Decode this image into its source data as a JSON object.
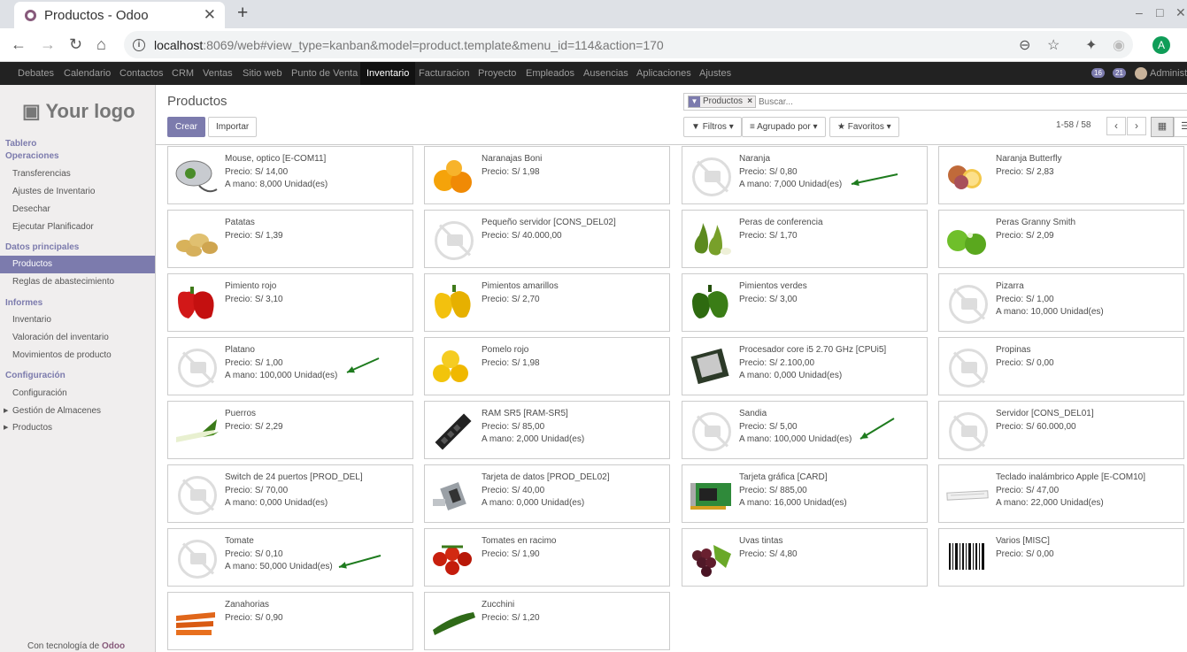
{
  "browser": {
    "tab_title": "Productos - Odoo",
    "url_host": "localhost",
    "url_rest": ":8069/web#view_type=kanban&model=product.template&menu_id=114&action=170",
    "profile_initial": "A"
  },
  "topmenu": {
    "items": [
      "Debates",
      "Calendario",
      "Contactos",
      "CRM",
      "Ventas",
      "Sitio web",
      "Punto de Venta",
      "Inventario",
      "Facturacion",
      "Proyecto",
      "Empleados",
      "Ausencias",
      "Aplicaciones",
      "Ajustes"
    ],
    "active": "Inventario",
    "badge_messages": "16",
    "badge_activities": "21",
    "user": "Administr"
  },
  "sidebar": {
    "logo": "Your logo",
    "dashboard": "Tablero",
    "sections": [
      {
        "title": "Operaciones",
        "items": [
          "Transferencias",
          "Ajustes de Inventario",
          "Desechar",
          "Ejecutar Planificador"
        ]
      },
      {
        "title": "Datos principales",
        "items": [
          "Productos",
          "Reglas de abastecimiento"
        ]
      },
      {
        "title": "Informes",
        "items": [
          "Inventario",
          "Valoración del inventario",
          "Movimientos de producto"
        ]
      },
      {
        "title": "Configuración",
        "items": [
          "Configuración",
          "Gestión de Almacenes",
          "Productos"
        ]
      }
    ],
    "selected": "Productos",
    "powered_prefix": "Con tecnología de ",
    "powered_brand": "Odoo"
  },
  "control_panel": {
    "title": "Productos",
    "create": "Crear",
    "import": "Importar",
    "facet": "Productos",
    "search_placeholder": "Buscar...",
    "filters": "Filtros",
    "group_by": "Agrupado por",
    "favorites": "Favoritos",
    "pager": "1-58 / 58"
  },
  "products": [
    {
      "name": "Mouse, optico [E-COM11]",
      "price": "Precio: S/ 14,00",
      "stock": "A mano: 8,000 Unidad(es)",
      "icon": "mouse"
    },
    {
      "name": "Naranajas Boni",
      "price": "Precio: S/ 1,98",
      "stock": "",
      "icon": "oranges"
    },
    {
      "name": "Naranja",
      "price": "Precio: S/ 0,80",
      "stock": "A mano: 7,000 Unidad(es)",
      "icon": "placeholder"
    },
    {
      "name": "Naranja Butterfly",
      "price": "Precio: S/ 2,83",
      "stock": "",
      "icon": "orange-slices"
    },
    {
      "name": "Patatas",
      "price": "Precio: S/ 1,39",
      "stock": "",
      "icon": "potatoes"
    },
    {
      "name": "Pequeño servidor [CONS_DEL02]",
      "price": "Precio: S/ 40.000,00",
      "stock": "",
      "icon": "placeholder"
    },
    {
      "name": "Peras de conferencia",
      "price": "Precio: S/ 1,70",
      "stock": "",
      "icon": "pears"
    },
    {
      "name": "Peras Granny Smith",
      "price": "Precio: S/ 2,09",
      "stock": "",
      "icon": "apples"
    },
    {
      "name": "Pimiento rojo",
      "price": "Precio: S/ 3,10",
      "stock": "",
      "icon": "red-pepper"
    },
    {
      "name": "Pimientos amarillos",
      "price": "Precio: S/ 2,70",
      "stock": "",
      "icon": "yellow-pepper"
    },
    {
      "name": "Pimientos verdes",
      "price": "Precio: S/ 3,00",
      "stock": "",
      "icon": "green-pepper"
    },
    {
      "name": "Pizarra",
      "price": "Precio: S/ 1,00",
      "stock": "A mano: 10,000 Unidad(es)",
      "icon": "placeholder"
    },
    {
      "name": "Platano",
      "price": "Precio: S/ 1,00",
      "stock": "A mano: 100,000 Unidad(es)",
      "icon": "placeholder"
    },
    {
      "name": "Pomelo rojo",
      "price": "Precio: S/ 1,98",
      "stock": "",
      "icon": "grapefruit"
    },
    {
      "name": "Procesador core i5 2.70 GHz [CPUi5]",
      "price": "Precio: S/ 2.100,00",
      "stock": "A mano: 0,000 Unidad(es)",
      "icon": "cpu"
    },
    {
      "name": "Propinas",
      "price": "Precio: S/ 0,00",
      "stock": "",
      "icon": "placeholder"
    },
    {
      "name": "Puerros",
      "price": "Precio: S/ 2,29",
      "stock": "",
      "icon": "leeks"
    },
    {
      "name": "RAM SR5 [RAM-SR5]",
      "price": "Precio: S/ 85,00",
      "stock": "A mano: 2,000 Unidad(es)",
      "icon": "ram"
    },
    {
      "name": "Sandia",
      "price": "Precio: S/ 5,00",
      "stock": "A mano: 100,000 Unidad(es)",
      "icon": "placeholder"
    },
    {
      "name": "Servidor [CONS_DEL01]",
      "price": "Precio: S/ 60.000,00",
      "stock": "",
      "icon": "placeholder"
    },
    {
      "name": "Switch de 24 puertos [PROD_DEL]",
      "price": "Precio: S/ 70,00",
      "stock": "A mano: 0,000 Unidad(es)",
      "icon": "placeholder"
    },
    {
      "name": "Tarjeta de datos [PROD_DEL02]",
      "price": "Precio: S/ 40,00",
      "stock": "A mano: 0,000 Unidad(es)",
      "icon": "usb-modem"
    },
    {
      "name": "Tarjeta gráfica [CARD]",
      "price": "Precio: S/ 885,00",
      "stock": "A mano: 16,000 Unidad(es)",
      "icon": "graphics-card"
    },
    {
      "name": "Teclado inalámbrico Apple [E-COM10]",
      "price": "Precio: S/ 47,00",
      "stock": "A mano: 22,000 Unidad(es)",
      "icon": "keyboard"
    },
    {
      "name": "Tomate",
      "price": "Precio: S/ 0,10",
      "stock": "A mano: 50,000 Unidad(es)",
      "icon": "placeholder"
    },
    {
      "name": "Tomates en racimo",
      "price": "Precio: S/ 1,90",
      "stock": "",
      "icon": "tomatoes"
    },
    {
      "name": "Uvas tintas",
      "price": "Precio: S/ 4,80",
      "stock": "",
      "icon": "grapes"
    },
    {
      "name": "Varios [MISC]",
      "price": "Precio: S/ 0,00",
      "stock": "",
      "icon": "barcode"
    },
    {
      "name": "Zanahorias",
      "price": "Precio: S/ 0,90",
      "stock": "",
      "icon": "carrots"
    },
    {
      "name": "Zucchini",
      "price": "Precio: S/ 1,20",
      "stock": "",
      "icon": "zucchini"
    }
  ],
  "annotations": {
    "arrows": [
      "Naranja",
      "Platano",
      "Sandia",
      "Tomate"
    ],
    "arrow_color": "#1e7b1e"
  },
  "colors": {
    "accent": "#7c7bad",
    "brand": "#875a7b",
    "menubar": "#222222"
  }
}
